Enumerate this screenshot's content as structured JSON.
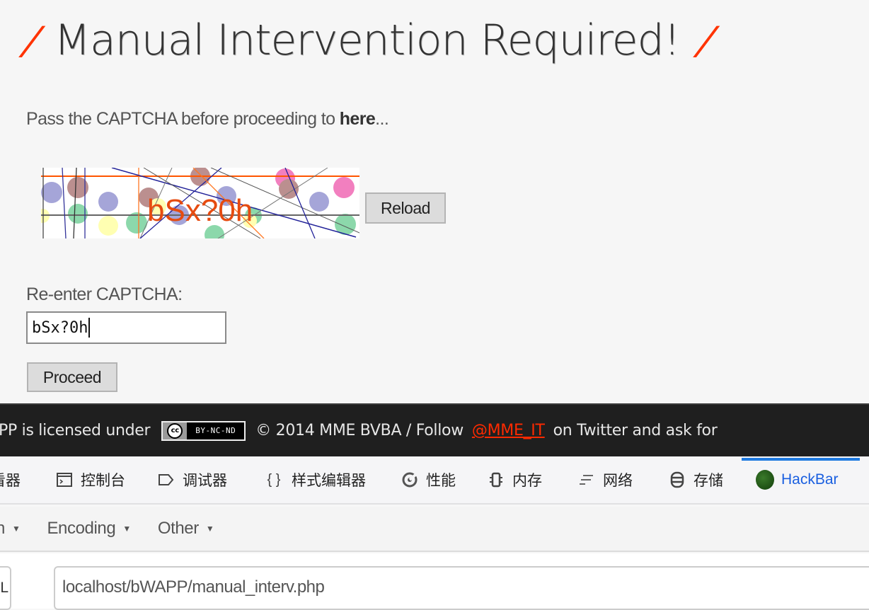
{
  "page": {
    "title": "Manual Intervention Required!",
    "title_decoration": "/",
    "intro_text": "Pass the CAPTCHA before proceeding to ",
    "intro_link": "here",
    "intro_suffix": "...",
    "captcha_text": "bSx?0h",
    "reload_label": "Reload",
    "reenter_label": "Re-enter CAPTCHA:",
    "captcha_input_value": "bSx?0h",
    "proceed_label": "Proceed"
  },
  "footer": {
    "lead_text": "PP is licensed under",
    "cc_icon": "cc",
    "cc_terms": "BY-NC-ND",
    "copyright": "© 2014 MME BVBA / Follow",
    "twitter_link": "@MME_IT",
    "tail_text": "on Twitter and ask for"
  },
  "devtools": {
    "tabs": [
      {
        "label": "查看器",
        "icon": "inspector-icon",
        "active": false
      },
      {
        "label": "控制台",
        "icon": "console-icon",
        "active": false
      },
      {
        "label": "调试器",
        "icon": "debugger-icon",
        "active": false
      },
      {
        "label": "样式编辑器",
        "icon": "style-editor-icon",
        "active": false
      },
      {
        "label": "性能",
        "icon": "performance-icon",
        "active": false
      },
      {
        "label": "内存",
        "icon": "memory-icon",
        "active": false
      },
      {
        "label": "网络",
        "icon": "network-icon",
        "active": false
      },
      {
        "label": "存储",
        "icon": "storage-icon",
        "active": false
      },
      {
        "label": "HackBar",
        "icon": "hackbar-icon",
        "active": true
      }
    ],
    "accent_color": "#1f7ae0"
  },
  "hackbar": {
    "menu": [
      {
        "label": "n"
      },
      {
        "label": "Encoding"
      },
      {
        "label": "Other"
      }
    ],
    "url_button": "URL",
    "url_value": "localhost/bWAPP/manual_interv.php"
  }
}
